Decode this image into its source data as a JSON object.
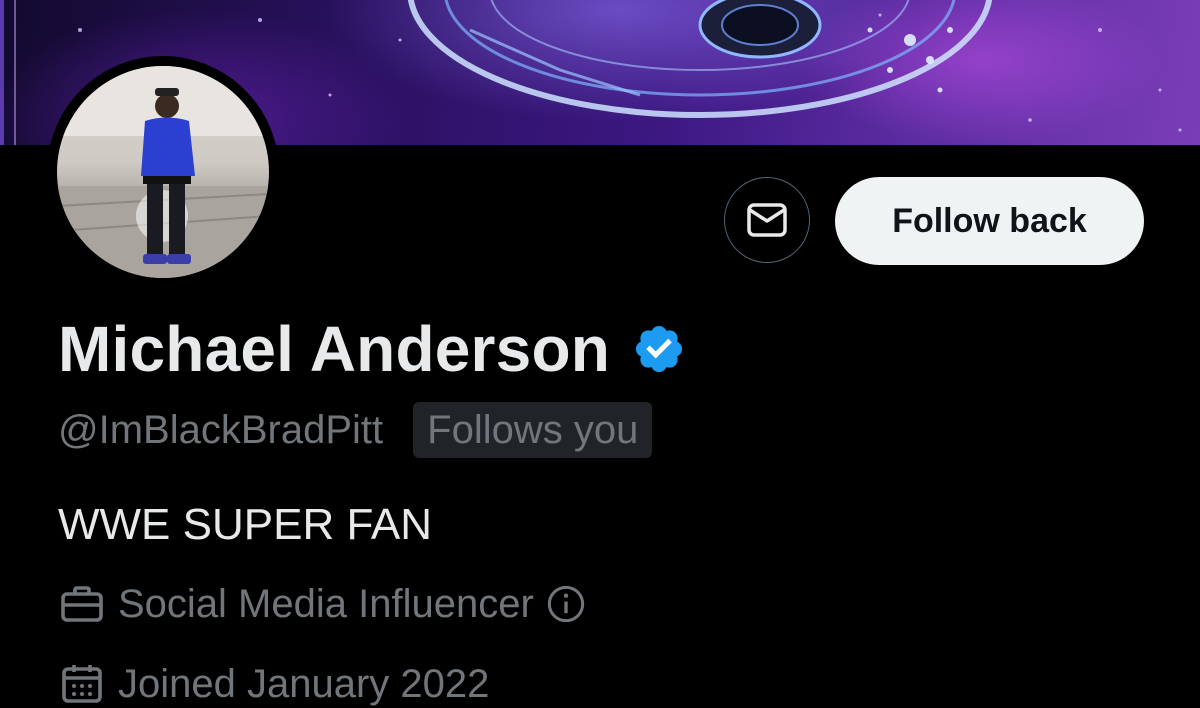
{
  "profile": {
    "display_name": "Michael Anderson",
    "handle": "@ImBlackBradPitt",
    "follows_you_label": "Follows you",
    "bio": "WWE SUPER FAN",
    "category": "Social Media Influencer",
    "joined": "Joined January 2022"
  },
  "actions": {
    "follow_back_label": "Follow back",
    "message_icon": "envelope-icon"
  },
  "colors": {
    "background": "#000000",
    "primary_text": "#e7e9ea",
    "secondary_text": "#71767b",
    "verified_blue": "#1d9bf0",
    "follow_button_bg": "#eff3f4",
    "follow_button_text": "#0f1419"
  },
  "icons": {
    "verified": "verified-badge-icon",
    "category": "briefcase-icon",
    "info": "info-icon",
    "joined": "calendar-icon"
  }
}
